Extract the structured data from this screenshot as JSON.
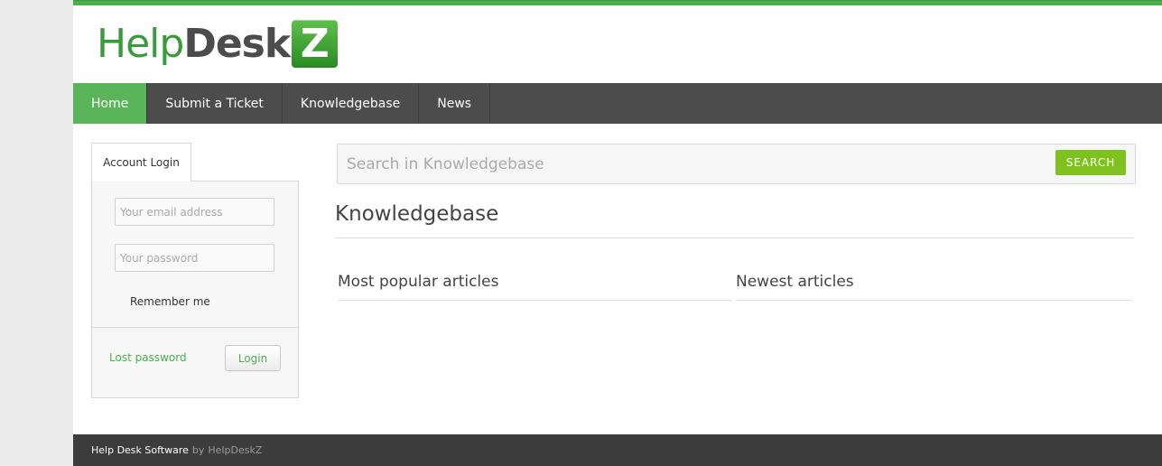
{
  "brand": {
    "help": "Help",
    "desk": "Desk",
    "z": "Z"
  },
  "nav": {
    "items": [
      {
        "label": "Home"
      },
      {
        "label": "Submit a Ticket"
      },
      {
        "label": "Knowledgebase"
      },
      {
        "label": "News"
      }
    ],
    "active": "Home"
  },
  "login": {
    "tab_label": "Account Login",
    "email_placeholder": "Your email address",
    "password_placeholder": "Your password",
    "remember_label": "Remember me",
    "lost_password": "Lost password",
    "login_button": "Login"
  },
  "search": {
    "placeholder": "Search in Knowledgebase",
    "button_label": "SEARCH"
  },
  "main": {
    "title": "Knowledgebase",
    "popular_title": "Most popular articles",
    "newest_title": "Newest articles"
  },
  "footer": {
    "text": "Help Desk Software",
    "by": "by",
    "brand": "HelpDeskZ"
  },
  "colors": {
    "accent": "#5ab55a",
    "nav_bg": "#4c4c4c",
    "search_button": "#7fc21d",
    "link": "#4caf50"
  }
}
